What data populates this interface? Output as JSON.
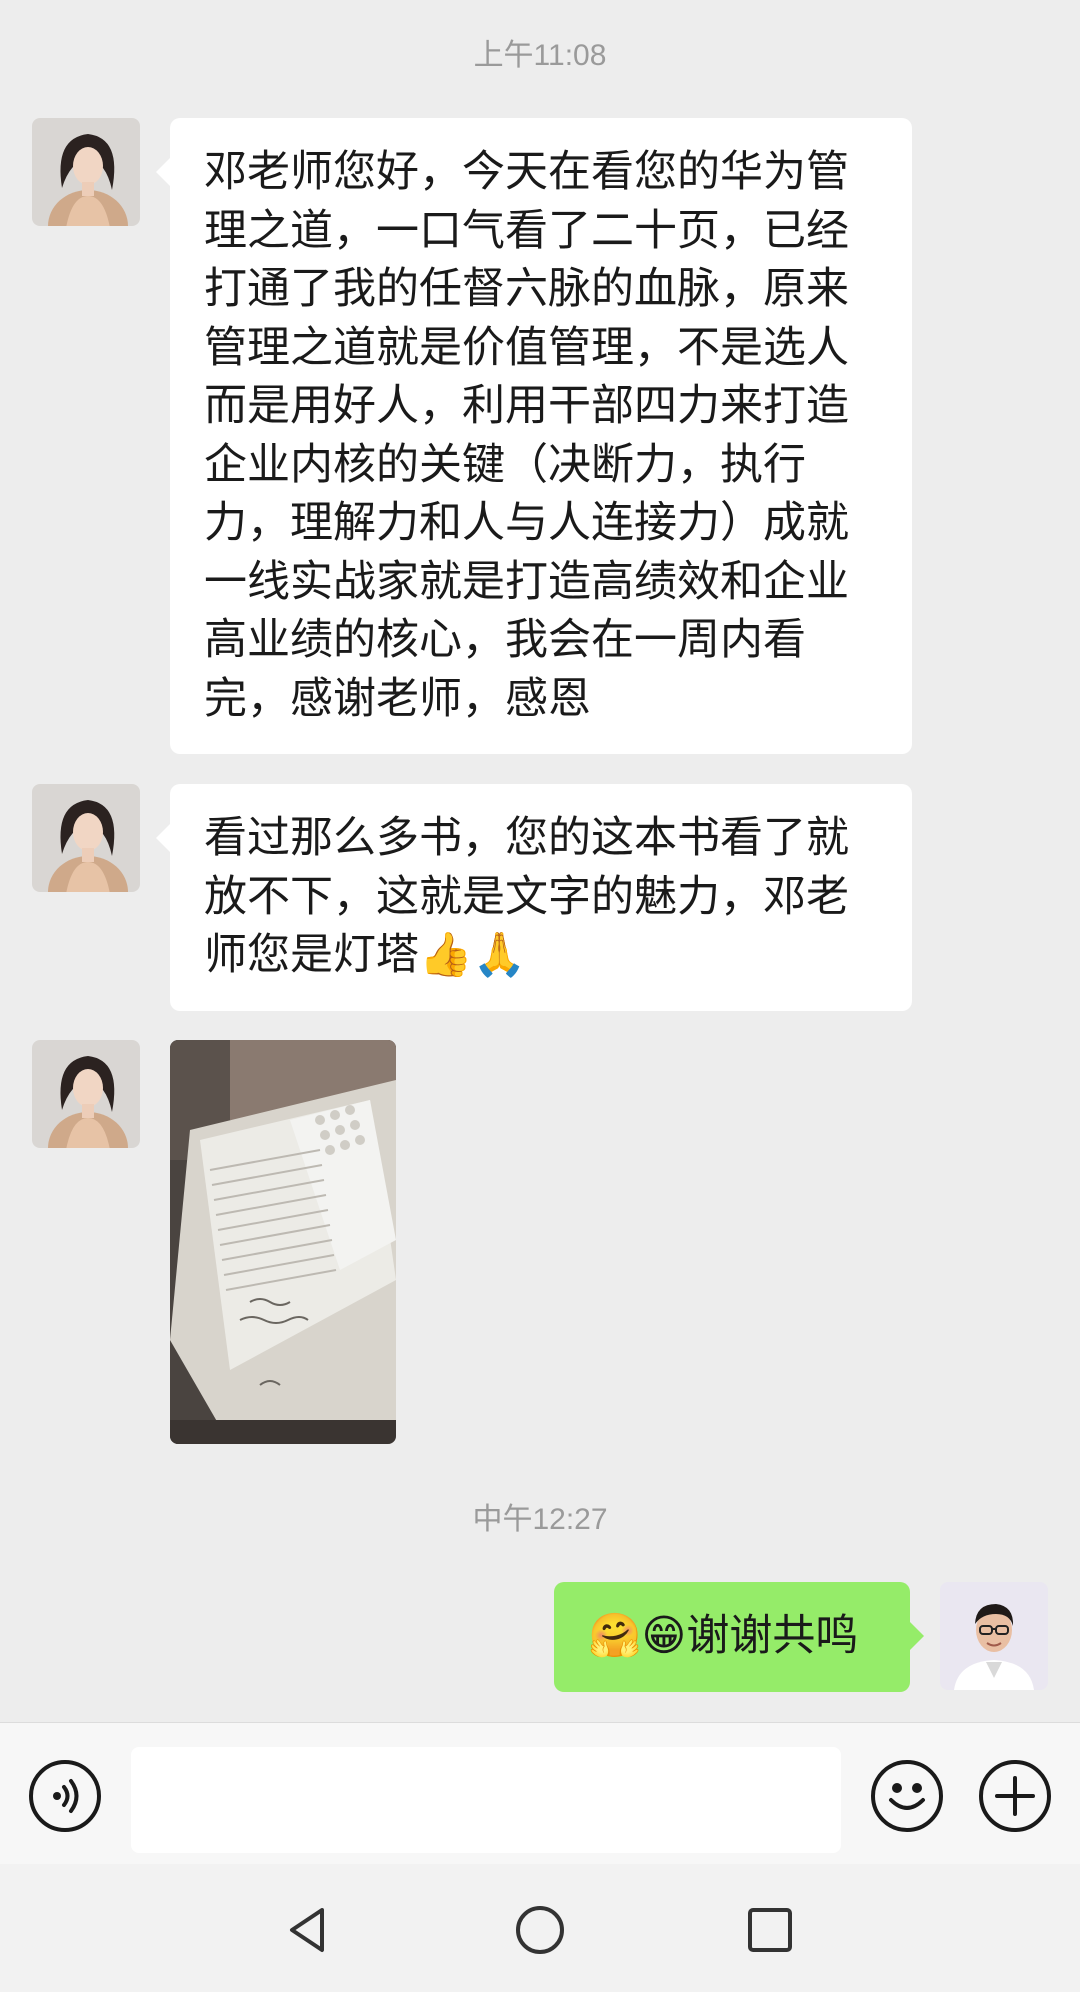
{
  "timestamps": [
    "上午11:08",
    "中午12:27"
  ],
  "messages": [
    {
      "sender": "contact",
      "lines": [
        "邓老师您好，今天在看您的华为管",
        "理之道，一口气看了二十页，已经",
        "打通了我的任督六脉的血脉，原来",
        "管理之道就是价值管理，不是选人",
        "而是用好人，利用干部四力来打造",
        "企业内核的关键（决断力，执行",
        "力，理解力和人与人连接力）成就",
        "一线实战家就是打造高绩效和企业",
        "高业绩的核心，我会在一周内看",
        "完，感谢老师，感恩"
      ]
    },
    {
      "sender": "contact",
      "lines": [
        "看过那么多书，您的这本书看了就",
        "放不下，这就是文字的魅力，邓老",
        "师您是灯塔👍🙏"
      ]
    },
    {
      "sender": "contact",
      "type": "image"
    },
    {
      "sender": "me",
      "lines": [
        "🤗😁谢谢共鸣"
      ]
    }
  ],
  "colors": {
    "chat_bg": "#ededed",
    "bubble_in": "#ffffff",
    "bubble_out": "#95ec69",
    "timestamp": "#9a9a9a"
  },
  "icons": {
    "voice": "voice-icon",
    "emoji": "emoji-icon",
    "plus": "plus-icon",
    "back": "nav-back-icon",
    "home": "nav-home-icon",
    "recents": "nav-recents-icon"
  }
}
